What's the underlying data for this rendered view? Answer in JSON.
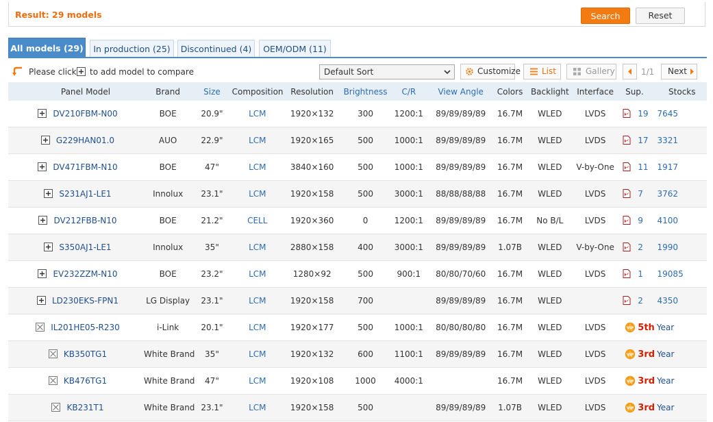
{
  "result": {
    "label": "Result: 29 models",
    "search_label": "Search",
    "reset_label": "Reset"
  },
  "tabs": [
    {
      "label": "All models (29)",
      "active": true
    },
    {
      "label": "In production (25)",
      "active": false
    },
    {
      "label": "Discontinued (4)",
      "active": false
    },
    {
      "label": "OEM/ODM (11)",
      "active": false
    }
  ],
  "toolbar": {
    "compare_text_1": "Please click",
    "compare_text_2": "to add model to compare",
    "sort_value": "Default Sort",
    "customize_label": "Customize",
    "list_label": "List",
    "gallery_label": "Gallery",
    "page_indicator": "1/1",
    "next_label": "Next"
  },
  "columns": [
    "Panel Model",
    "Brand",
    "Size",
    "Composition",
    "Resolution",
    "Brightness",
    "C/R",
    "View Angle",
    "Colors",
    "Backlight",
    "Interface",
    "Sup.",
    "Stocks"
  ],
  "rows": [
    {
      "model": "DV210FBM-N00",
      "brand": "BOE",
      "size": "20.9\"",
      "comp": "LCM",
      "res": "1920×132",
      "bright": "300",
      "cr": "1200:1",
      "view": "89/89/89/89",
      "colors": "16.7M",
      "backlight": "WLED",
      "iface": "LVDS",
      "sup": "19",
      "stock": "7645"
    },
    {
      "model": "G229HAN01.0",
      "brand": "AUO",
      "size": "22.9\"",
      "comp": "LCM",
      "res": "1920×165",
      "bright": "500",
      "cr": "1000:1",
      "view": "89/89/89/89",
      "colors": "16.7M",
      "backlight": "WLED",
      "iface": "LVDS",
      "sup": "17",
      "stock": "3321"
    },
    {
      "model": "DV471FBM-N10",
      "brand": "BOE",
      "size": "47\"",
      "comp": "LCM",
      "res": "3840×160",
      "bright": "500",
      "cr": "1000:1",
      "view": "89/89/89/89",
      "colors": "16.7M",
      "backlight": "WLED",
      "iface": "V-by-One",
      "sup": "11",
      "stock": "1917"
    },
    {
      "model": "S231AJ1-LE1",
      "brand": "Innolux",
      "size": "23.1\"",
      "comp": "LCM",
      "res": "1920×158",
      "bright": "500",
      "cr": "3000:1",
      "view": "88/88/88/88",
      "colors": "16.7M",
      "backlight": "WLED",
      "iface": "LVDS",
      "sup": "7",
      "stock": "3762"
    },
    {
      "model": "DV212FBB-N10",
      "brand": "BOE",
      "size": "21.2\"",
      "comp": "CELL",
      "res": "1920×360",
      "bright": "0",
      "cr": "1200:1",
      "view": "89/89/89/89",
      "colors": "16.7M",
      "backlight": "No B/L",
      "iface": "LVDS",
      "sup": "9",
      "stock": "4100"
    },
    {
      "model": "S350AJ1-LE1",
      "brand": "Innolux",
      "size": "35\"",
      "comp": "LCM",
      "res": "2880×158",
      "bright": "400",
      "cr": "3000:1",
      "view": "89/89/89/89",
      "colors": "1.07B",
      "backlight": "WLED",
      "iface": "V-by-One",
      "sup": "2",
      "stock": "1990"
    },
    {
      "model": "EV232ZZM-N10",
      "brand": "BOE",
      "size": "23.2\"",
      "comp": "LCM",
      "res": "1280×92",
      "bright": "500",
      "cr": "900:1",
      "view": "80/80/70/60",
      "colors": "16.7M",
      "backlight": "WLED",
      "iface": "LVDS",
      "sup": "1",
      "stock": "19085"
    },
    {
      "model": "LD230EKS-FPN1",
      "brand": "LG Display",
      "size": "23.1\"",
      "comp": "LCM",
      "res": "1920×158",
      "bright": "700",
      "cr": "",
      "view": "89/89/89/89",
      "colors": "16.7M",
      "backlight": "WLED",
      "iface": "",
      "sup": "2",
      "stock": "4350"
    },
    {
      "model": "IL201HE05-R230",
      "brand": "i-Link",
      "size": "20.1\"",
      "comp": "LCM",
      "res": "1920×177",
      "bright": "500",
      "cr": "1000:1",
      "view": "80/80/80/80",
      "colors": "16.7M",
      "backlight": "WLED",
      "iface": "LVDS",
      "vip_years": "5th",
      "vip_label": "Year"
    },
    {
      "model": "KB350TG1",
      "brand": "White Brand",
      "size": "35\"",
      "comp": "LCM",
      "res": "1920×132",
      "bright": "600",
      "cr": "1100:1",
      "view": "89/89/89/89",
      "colors": "16.7M",
      "backlight": "WLED",
      "iface": "LVDS",
      "vip_years": "3rd",
      "vip_label": "Year"
    },
    {
      "model": "KB476TG1",
      "brand": "White Brand",
      "size": "47\"",
      "comp": "LCM",
      "res": "1920×108",
      "bright": "1000",
      "cr": "4000:1",
      "view": "",
      "colors": "16.7M",
      "backlight": "WLED",
      "iface": "LVDS",
      "vip_years": "3rd",
      "vip_label": "Year"
    },
    {
      "model": "KB231T1",
      "brand": "White Brand",
      "size": "23.1\"",
      "comp": "LCM",
      "res": "1920×158",
      "bright": "500",
      "cr": "",
      "view": "89/89/89/89",
      "colors": "1.07B",
      "backlight": "WLED",
      "iface": "LVDS",
      "vip_years": "3rd",
      "vip_label": "Year"
    }
  ]
}
